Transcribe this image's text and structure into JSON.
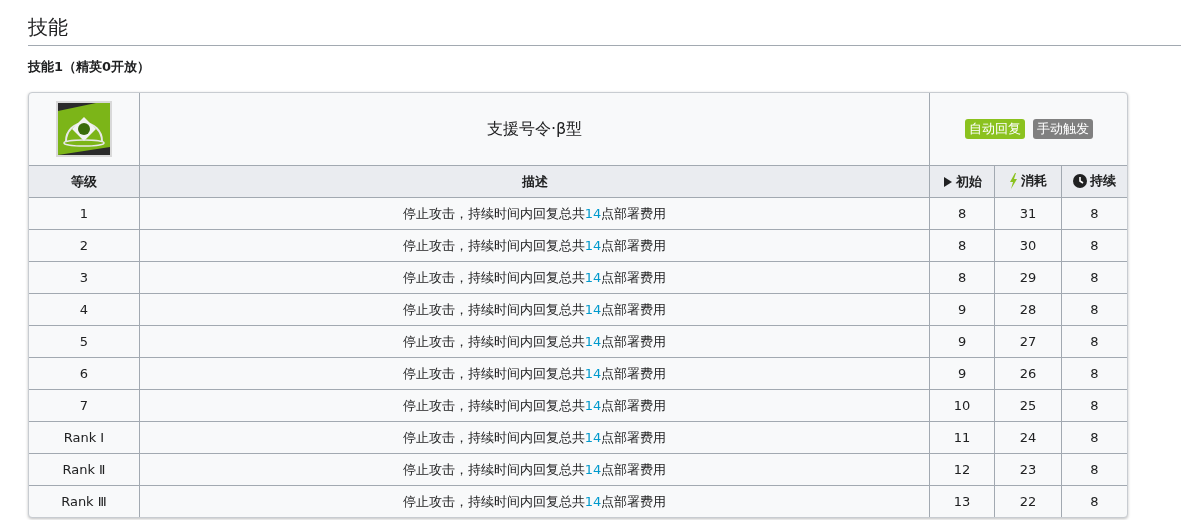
{
  "section_title": "技能",
  "skill_heading": "技能1（精英0开放）",
  "skill": {
    "name": "支援号令·β型",
    "tags": [
      {
        "label": "自动回复",
        "color": "#8bc21f"
      },
      {
        "label": "手动触发",
        "color": "#808080"
      }
    ]
  },
  "columns": [
    "等级",
    "描述",
    "初始",
    "消耗",
    "持续"
  ],
  "rows": [
    {
      "level": "1",
      "description": {
        "before": "停止攻击，持续时间内回复总共",
        "value": "14",
        "after": "点部署费用"
      },
      "initial": "8",
      "cost": "31",
      "duration": "8"
    },
    {
      "level": "2",
      "description": {
        "before": "停止攻击，持续时间内回复总共",
        "value": "14",
        "after": "点部署费用"
      },
      "initial": "8",
      "cost": "30",
      "duration": "8"
    },
    {
      "level": "3",
      "description": {
        "before": "停止攻击，持续时间内回复总共",
        "value": "14",
        "after": "点部署费用"
      },
      "initial": "8",
      "cost": "29",
      "duration": "8"
    },
    {
      "level": "4",
      "description": {
        "before": "停止攻击，持续时间内回复总共",
        "value": "14",
        "after": "点部署费用"
      },
      "initial": "9",
      "cost": "28",
      "duration": "8"
    },
    {
      "level": "5",
      "description": {
        "before": "停止攻击，持续时间内回复总共",
        "value": "14",
        "after": "点部署费用"
      },
      "initial": "9",
      "cost": "27",
      "duration": "8"
    },
    {
      "level": "6",
      "description": {
        "before": "停止攻击，持续时间内回复总共",
        "value": "14",
        "after": "点部署费用"
      },
      "initial": "9",
      "cost": "26",
      "duration": "8"
    },
    {
      "level": "7",
      "description": {
        "before": "停止攻击，持续时间内回复总共",
        "value": "14",
        "after": "点部署费用"
      },
      "initial": "10",
      "cost": "25",
      "duration": "8"
    },
    {
      "level": "Rank Ⅰ",
      "description": {
        "before": "停止攻击，持续时间内回复总共",
        "value": "14",
        "after": "点部署费用"
      },
      "initial": "11",
      "cost": "24",
      "duration": "8"
    },
    {
      "level": "Rank Ⅱ",
      "description": {
        "before": "停止攻击，持续时间内回复总共",
        "value": "14",
        "after": "点部署费用"
      },
      "initial": "12",
      "cost": "23",
      "duration": "8"
    },
    {
      "level": "Rank Ⅲ",
      "description": {
        "before": "停止攻击，持续时间内回复总共",
        "value": "14",
        "after": "点部署费用"
      },
      "initial": "13",
      "cost": "22",
      "duration": "8"
    }
  ]
}
